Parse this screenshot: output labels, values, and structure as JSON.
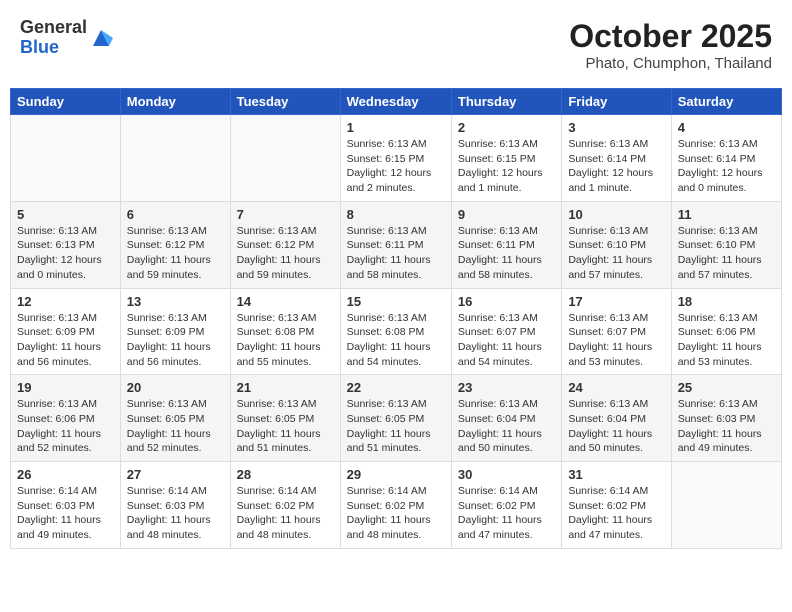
{
  "header": {
    "logo_general": "General",
    "logo_blue": "Blue",
    "month": "October 2025",
    "location": "Phato, Chumphon, Thailand"
  },
  "weekdays": [
    "Sunday",
    "Monday",
    "Tuesday",
    "Wednesday",
    "Thursday",
    "Friday",
    "Saturday"
  ],
  "weeks": [
    [
      {
        "day": "",
        "info": ""
      },
      {
        "day": "",
        "info": ""
      },
      {
        "day": "",
        "info": ""
      },
      {
        "day": "1",
        "info": "Sunrise: 6:13 AM\nSunset: 6:15 PM\nDaylight: 12 hours\nand 2 minutes."
      },
      {
        "day": "2",
        "info": "Sunrise: 6:13 AM\nSunset: 6:15 PM\nDaylight: 12 hours\nand 1 minute."
      },
      {
        "day": "3",
        "info": "Sunrise: 6:13 AM\nSunset: 6:14 PM\nDaylight: 12 hours\nand 1 minute."
      },
      {
        "day": "4",
        "info": "Sunrise: 6:13 AM\nSunset: 6:14 PM\nDaylight: 12 hours\nand 0 minutes."
      }
    ],
    [
      {
        "day": "5",
        "info": "Sunrise: 6:13 AM\nSunset: 6:13 PM\nDaylight: 12 hours\nand 0 minutes."
      },
      {
        "day": "6",
        "info": "Sunrise: 6:13 AM\nSunset: 6:12 PM\nDaylight: 11 hours\nand 59 minutes."
      },
      {
        "day": "7",
        "info": "Sunrise: 6:13 AM\nSunset: 6:12 PM\nDaylight: 11 hours\nand 59 minutes."
      },
      {
        "day": "8",
        "info": "Sunrise: 6:13 AM\nSunset: 6:11 PM\nDaylight: 11 hours\nand 58 minutes."
      },
      {
        "day": "9",
        "info": "Sunrise: 6:13 AM\nSunset: 6:11 PM\nDaylight: 11 hours\nand 58 minutes."
      },
      {
        "day": "10",
        "info": "Sunrise: 6:13 AM\nSunset: 6:10 PM\nDaylight: 11 hours\nand 57 minutes."
      },
      {
        "day": "11",
        "info": "Sunrise: 6:13 AM\nSunset: 6:10 PM\nDaylight: 11 hours\nand 57 minutes."
      }
    ],
    [
      {
        "day": "12",
        "info": "Sunrise: 6:13 AM\nSunset: 6:09 PM\nDaylight: 11 hours\nand 56 minutes."
      },
      {
        "day": "13",
        "info": "Sunrise: 6:13 AM\nSunset: 6:09 PM\nDaylight: 11 hours\nand 56 minutes."
      },
      {
        "day": "14",
        "info": "Sunrise: 6:13 AM\nSunset: 6:08 PM\nDaylight: 11 hours\nand 55 minutes."
      },
      {
        "day": "15",
        "info": "Sunrise: 6:13 AM\nSunset: 6:08 PM\nDaylight: 11 hours\nand 54 minutes."
      },
      {
        "day": "16",
        "info": "Sunrise: 6:13 AM\nSunset: 6:07 PM\nDaylight: 11 hours\nand 54 minutes."
      },
      {
        "day": "17",
        "info": "Sunrise: 6:13 AM\nSunset: 6:07 PM\nDaylight: 11 hours\nand 53 minutes."
      },
      {
        "day": "18",
        "info": "Sunrise: 6:13 AM\nSunset: 6:06 PM\nDaylight: 11 hours\nand 53 minutes."
      }
    ],
    [
      {
        "day": "19",
        "info": "Sunrise: 6:13 AM\nSunset: 6:06 PM\nDaylight: 11 hours\nand 52 minutes."
      },
      {
        "day": "20",
        "info": "Sunrise: 6:13 AM\nSunset: 6:05 PM\nDaylight: 11 hours\nand 52 minutes."
      },
      {
        "day": "21",
        "info": "Sunrise: 6:13 AM\nSunset: 6:05 PM\nDaylight: 11 hours\nand 51 minutes."
      },
      {
        "day": "22",
        "info": "Sunrise: 6:13 AM\nSunset: 6:05 PM\nDaylight: 11 hours\nand 51 minutes."
      },
      {
        "day": "23",
        "info": "Sunrise: 6:13 AM\nSunset: 6:04 PM\nDaylight: 11 hours\nand 50 minutes."
      },
      {
        "day": "24",
        "info": "Sunrise: 6:13 AM\nSunset: 6:04 PM\nDaylight: 11 hours\nand 50 minutes."
      },
      {
        "day": "25",
        "info": "Sunrise: 6:13 AM\nSunset: 6:03 PM\nDaylight: 11 hours\nand 49 minutes."
      }
    ],
    [
      {
        "day": "26",
        "info": "Sunrise: 6:14 AM\nSunset: 6:03 PM\nDaylight: 11 hours\nand 49 minutes."
      },
      {
        "day": "27",
        "info": "Sunrise: 6:14 AM\nSunset: 6:03 PM\nDaylight: 11 hours\nand 48 minutes."
      },
      {
        "day": "28",
        "info": "Sunrise: 6:14 AM\nSunset: 6:02 PM\nDaylight: 11 hours\nand 48 minutes."
      },
      {
        "day": "29",
        "info": "Sunrise: 6:14 AM\nSunset: 6:02 PM\nDaylight: 11 hours\nand 48 minutes."
      },
      {
        "day": "30",
        "info": "Sunrise: 6:14 AM\nSunset: 6:02 PM\nDaylight: 11 hours\nand 47 minutes."
      },
      {
        "day": "31",
        "info": "Sunrise: 6:14 AM\nSunset: 6:02 PM\nDaylight: 11 hours\nand 47 minutes."
      },
      {
        "day": "",
        "info": ""
      }
    ]
  ]
}
